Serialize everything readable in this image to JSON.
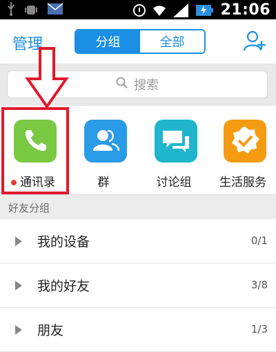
{
  "status_bar": {
    "time": "21:06",
    "icons": [
      "usb-icon",
      "android-debug-icon",
      "mail-icon",
      "alarm-icon",
      "wifi-icon",
      "signal-icon",
      "battery-charging-icon"
    ]
  },
  "header": {
    "manage_label": "管理",
    "tabs": [
      {
        "label": "分组",
        "selected": true
      },
      {
        "label": "全部",
        "selected": false
      }
    ],
    "add_icon": "add-contact-icon"
  },
  "search": {
    "placeholder": "搜索",
    "icon": "search-icon"
  },
  "shortcuts": [
    {
      "label": "通讯录",
      "icon": "phone-icon",
      "color": "#7ac943",
      "badge_dot": true
    },
    {
      "label": "群",
      "icon": "group-icon",
      "color": "#2a9be6",
      "badge_dot": false
    },
    {
      "label": "讨论组",
      "icon": "chat-bubbles-icon",
      "color": "#1fb6cd",
      "badge_dot": false
    },
    {
      "label": "生活服务",
      "icon": "badge-check-icon",
      "color": "#f59b12",
      "badge_dot": false
    }
  ],
  "section_title": "好友分组",
  "groups": [
    {
      "name": "我的设备",
      "count": "0/1"
    },
    {
      "name": "我的好友",
      "count": "3/8"
    },
    {
      "name": "朋友",
      "count": "1/3"
    }
  ],
  "colors": {
    "accent": "#1a8fe3",
    "annotation_red": "#e0192a"
  }
}
